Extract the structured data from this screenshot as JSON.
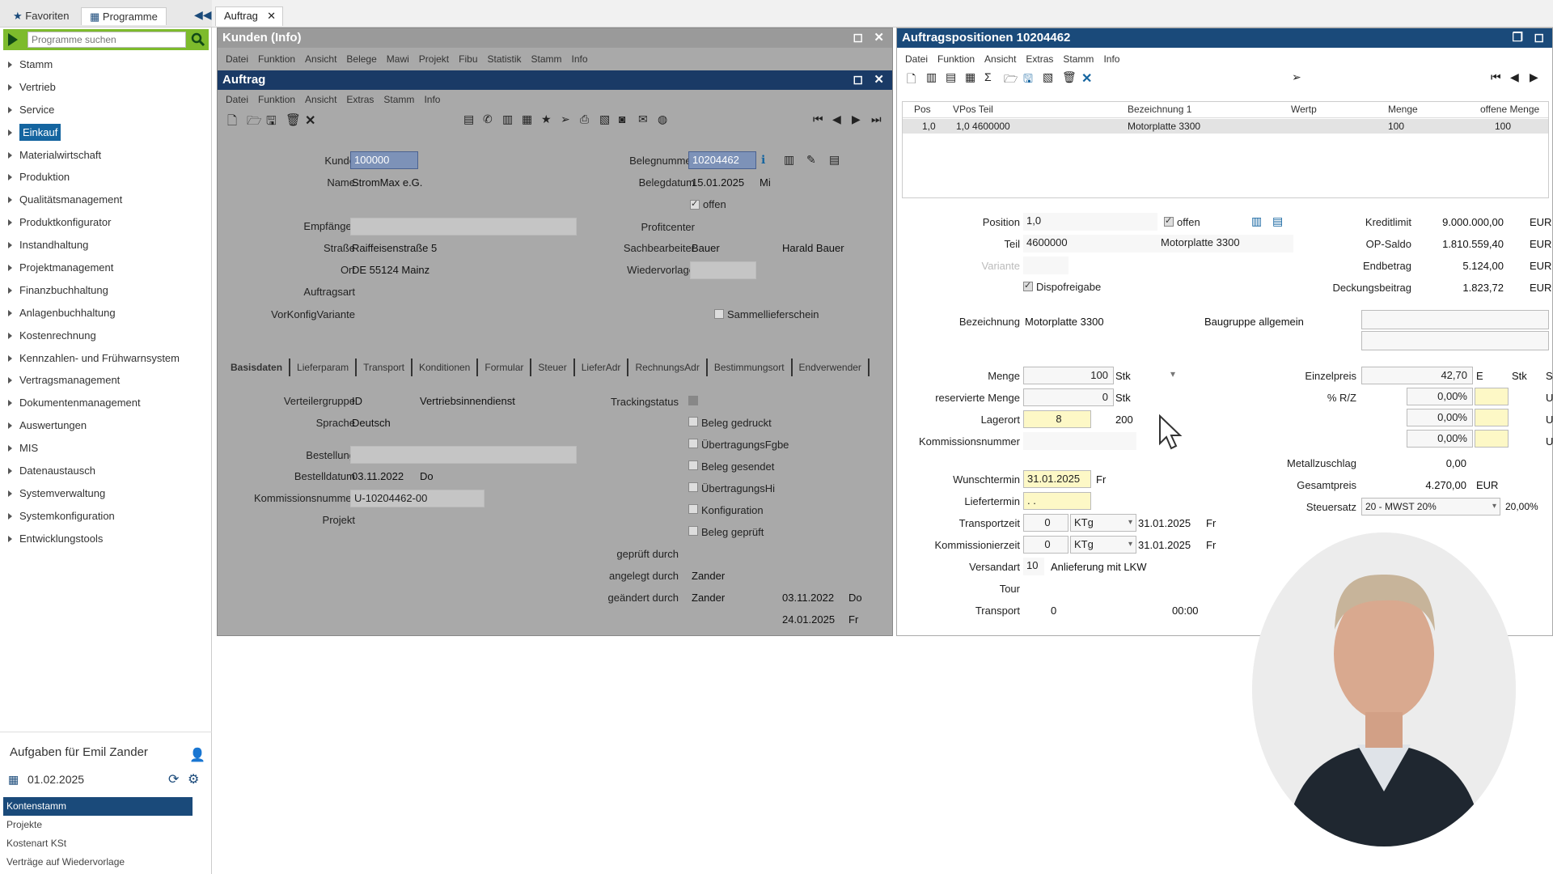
{
  "sidebar": {
    "tabs": [
      "Favoriten",
      "Programme"
    ],
    "search_placeholder": "Programme suchen",
    "items": [
      "Stamm",
      "Vertrieb",
      "Service",
      "Einkauf",
      "Materialwirtschaft",
      "Produktion",
      "Qualitätsmanagement",
      "Produktkonfigurator",
      "Instandhaltung",
      "Projektmanagement",
      "Finanzbuchhaltung",
      "Anlagenbuchhaltung",
      "Kostenrechnung",
      "Kennzahlen- und Frühwarnsystem",
      "Vertragsmanagement",
      "Dokumentenmanagement",
      "Auswertungen",
      "MIS",
      "Datenaustausch",
      "Systemverwaltung",
      "Systemkonfiguration",
      "Entwicklungstools"
    ],
    "selected": "Einkauf",
    "tasks_title": "Aufgaben für Emil Zander",
    "tasks_date": "01.02.2025",
    "task_items": [
      "Kontenstamm",
      "Projekte",
      "Kostenart KSt",
      "Verträge auf Wiedervorlage"
    ]
  },
  "doctab": "Auftrag",
  "kunden": {
    "title": "Kunden (Info)",
    "menu": [
      "Datei",
      "Funktion",
      "Ansicht",
      "Belege",
      "Mawi",
      "Projekt",
      "Fibu",
      "Statistik",
      "Stamm",
      "Info"
    ]
  },
  "auftrag": {
    "title": "Auftrag",
    "menu": [
      "Datei",
      "Funktion",
      "Ansicht",
      "Extras",
      "Stamm",
      "Info"
    ],
    "labels": {
      "kunde": "Kunde",
      "name": "Name",
      "empfaenger": "Empfänger",
      "strasse": "Straße",
      "ort": "Ort",
      "auftragsart": "Auftragsart",
      "vorkonfig": "VorKonfigVariante",
      "belegnummer": "Belegnummer",
      "belegdatum": "Belegdatum",
      "profitcenter": "Profitcenter",
      "sachbearbeiter": "Sachbearbeiter",
      "wiedervorlage": "Wiedervorlage"
    },
    "values": {
      "kunde": "100000",
      "name": "StromMax e.G.",
      "strasse": "Raiffeisenstraße 5",
      "ort": "DE 55124 Mainz",
      "belegnummer": "10204462",
      "belegdatum": "15.01.2025",
      "belegtag": "Mi",
      "sachbearbeiter": "Bauer",
      "sachbearbeiter_name": "Harald Bauer"
    },
    "offen": "offen",
    "sammel": "Sammellieferschein",
    "tabs": [
      "Basisdaten",
      "Lieferparam",
      "Transport",
      "Konditionen",
      "Formular",
      "Steuer",
      "LieferAdr",
      "RechnungsAdr",
      "Bestimmungsort",
      "Endverwender"
    ],
    "basis": {
      "verteilergruppe_lbl": "Verteilergruppe",
      "verteilergruppe_id": "ID",
      "verteilergruppe": "Vertriebsinnendienst",
      "sprache_lbl": "Sprache",
      "sprache": "Deutsch",
      "bestellung_lbl": "Bestellung",
      "bestelldatum_lbl": "Bestelldatum",
      "bestelldatum": "03.11.2022",
      "bestelltag": "Do",
      "kommission_lbl": "Kommissionsnummer",
      "kommission": "U-10204462-00",
      "projekt_lbl": "Projekt",
      "trackingstatus": "Trackingstatus",
      "checks": [
        "Beleg gedruckt",
        "ÜbertragungsFgbe",
        "Beleg gesendet",
        "ÜbertragungsHi",
        "Konfiguration",
        "Beleg geprüft"
      ],
      "geprueft": "geprüft durch",
      "angelegt": "angelegt durch",
      "angelegt_val": "Zander",
      "geaendert": "geändert durch",
      "geaendert_val": "Zander",
      "geaendert_datum": "03.11.2022",
      "geaendert_tag": "Do",
      "datum2": "24.01.2025",
      "tag2": "Fr"
    }
  },
  "positionen": {
    "title": "Auftragspositionen 10204462",
    "menu": [
      "Datei",
      "Funktion",
      "Ansicht",
      "Extras",
      "Stamm",
      "Info"
    ],
    "grid_headers": [
      "Pos",
      "VPos Teil",
      "Bezeichnung 1",
      "Wertp",
      "Menge",
      "offene Menge"
    ],
    "grid_row": [
      "1,0",
      "1,0 4600000",
      "Motorplatte 3300",
      "",
      "100",
      "100"
    ],
    "labels": {
      "position": "Position",
      "teil": "Teil",
      "variante": "Variante",
      "dispo": "Dispofreigabe",
      "bezeichnung": "Bezeichnung",
      "baugruppe": "Baugruppe allgemein",
      "menge": "Menge",
      "reserviert": "reservierte Menge",
      "lagerort": "Lagerort",
      "kommission": "Kommissionsnummer",
      "wunsch": "Wunschtermin",
      "liefer": "Liefertermin",
      "transportzeit": "Transportzeit",
      "kommzeit": "Kommissionierzeit",
      "versandart": "Versandart",
      "tour": "Tour",
      "transport": "Transport"
    },
    "values": {
      "position": "1,0",
      "offen": "offen",
      "teil": "4600000",
      "teil_bez": "Motorplatte 3300",
      "bezeichnung": "Motorplatte 3300",
      "menge": "100",
      "menge_unit": "Stk",
      "reserviert": "0",
      "res_unit": "Stk",
      "lagerort": "8",
      "lager_val": "200",
      "wunsch": "31.01.2025",
      "wunsch_tag": "Fr",
      "liefer": ". .",
      "tz": "0",
      "tz_unit": "KTg",
      "tz_date": "31.01.2025",
      "tz_tag": "Fr",
      "kz": "0",
      "kz_unit": "KTg",
      "kz_date": "31.01.2025",
      "kz_tag": "Fr",
      "versand": "10",
      "versand_txt": "Anlieferung mit LKW",
      "transport": "0",
      "transport_time": "00:00"
    },
    "fin": {
      "kredit_lbl": "Kreditlimit",
      "kredit": "9.000.000,00",
      "op_lbl": "OP-Saldo",
      "op": "1.810.559,40",
      "end_lbl": "Endbetrag",
      "end": "5.124,00",
      "deck_lbl": "Deckungsbeitrag",
      "deck": "1.823,72",
      "cur": "EUR",
      "einzel_lbl": "Einzelpreis",
      "einzel": "42,70",
      "einzel_e": "E",
      "einzel_stk": "Stk",
      "einzel_s": "S",
      "rz_lbl": "% R/Z",
      "rz1": "0,00%",
      "rz2": "0,00%",
      "rz3": "0,00%",
      "u": "U",
      "metall_lbl": "Metallzuschlag",
      "metall": "0,00",
      "gesamt_lbl": "Gesamtpreis",
      "gesamt": "4.270,00",
      "gesamt_cur": "EUR",
      "steuer_lbl": "Steuersatz",
      "steuer": "20 - MWST 20%",
      "steuer_pct": "20,00%"
    }
  },
  "colors": {
    "titlebar": "#1a4a7a",
    "accent": "#7dbb2c",
    "selected": "#1565a0"
  }
}
